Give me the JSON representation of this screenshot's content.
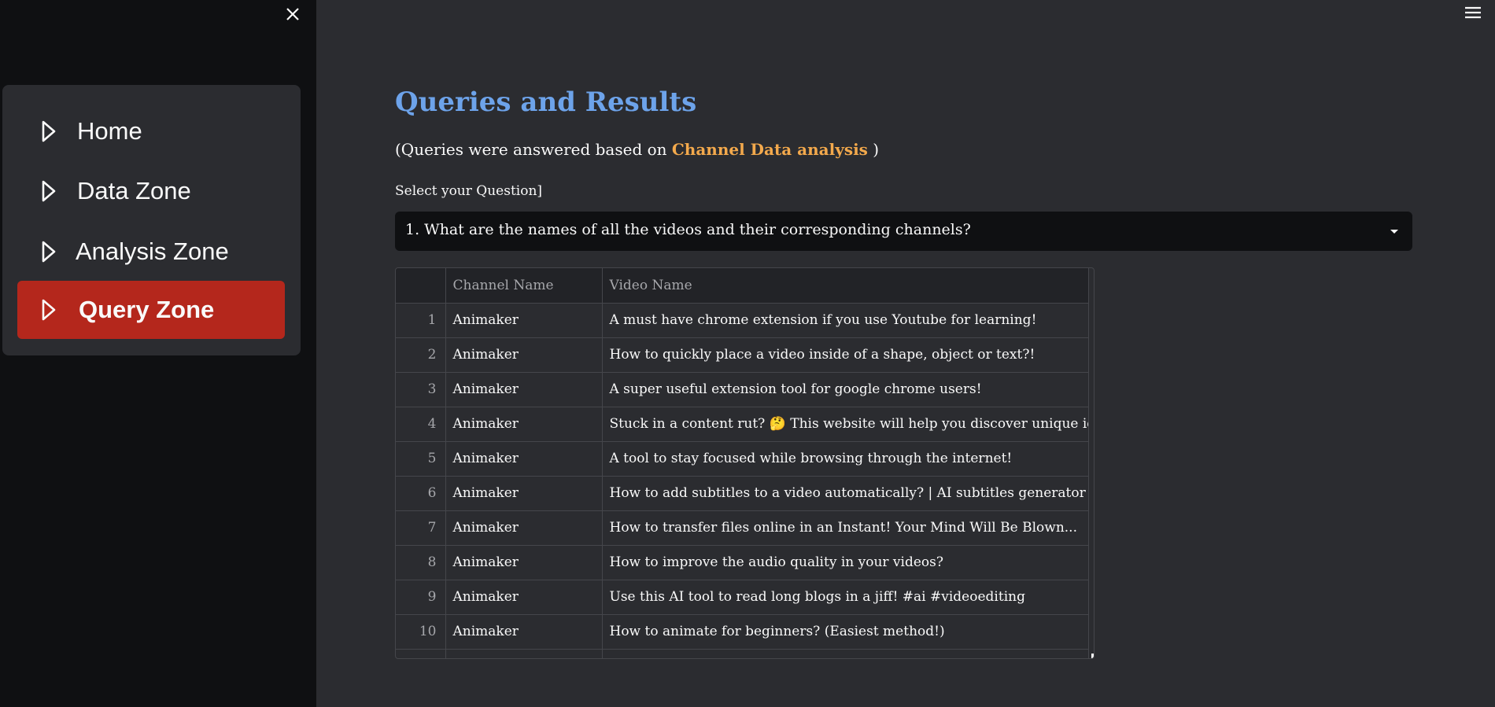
{
  "sidebar": {
    "items": [
      {
        "label": "Home",
        "active": false
      },
      {
        "label": "Data Zone",
        "active": false
      },
      {
        "label": "Analysis Zone",
        "active": false
      },
      {
        "label": "Query Zone",
        "active": true
      }
    ],
    "close_icon": "close-icon",
    "nav_icon": "play-triangle-icon",
    "active_color": "#b4271c"
  },
  "header": {
    "menu_icon": "hamburger-icon"
  },
  "main": {
    "title": "Queries and Results",
    "subtitle_prefix": "(Queries were answered based on ",
    "subtitle_highlight": "Channel Data analysis",
    "subtitle_suffix": " )",
    "select_label": "Select your Question]",
    "selected_question": "1. What are the names of all the videos and their corresponding channels?",
    "title_color": "#6da3ea",
    "highlight_color": "#f3a94c"
  },
  "table": {
    "columns": [
      "",
      "Channel Name",
      "Video Name"
    ],
    "rows": [
      {
        "idx": "1",
        "channel": "Animaker",
        "video": "A must have chrome extension if you use Youtube for learning!"
      },
      {
        "idx": "2",
        "channel": "Animaker",
        "video": "How to quickly place a video inside of a shape, object or text?!"
      },
      {
        "idx": "3",
        "channel": "Animaker",
        "video": "A super useful extension tool for google chrome users!"
      },
      {
        "idx": "4",
        "channel": "Animaker",
        "video": "Stuck in a content rut? 🤔  This website will help you discover unique ideas. 🚀"
      },
      {
        "idx": "5",
        "channel": "Animaker",
        "video": "A tool to stay focused while browsing through the internet!"
      },
      {
        "idx": "6",
        "channel": "Animaker",
        "video": "How to add subtitles to a video automatically? | AI subtitles generator"
      },
      {
        "idx": "7",
        "channel": "Animaker",
        "video": "How to transfer files online in an Instant! Your Mind Will Be Blown..."
      },
      {
        "idx": "8",
        "channel": "Animaker",
        "video": "How to improve the audio quality in your videos?"
      },
      {
        "idx": "9",
        "channel": "Animaker",
        "video": "Use this AI tool to read long blogs in a jiff! #ai #videoediting"
      },
      {
        "idx": "10",
        "channel": "Animaker",
        "video": "How to animate for beginners? (Easiest method!)"
      }
    ]
  }
}
